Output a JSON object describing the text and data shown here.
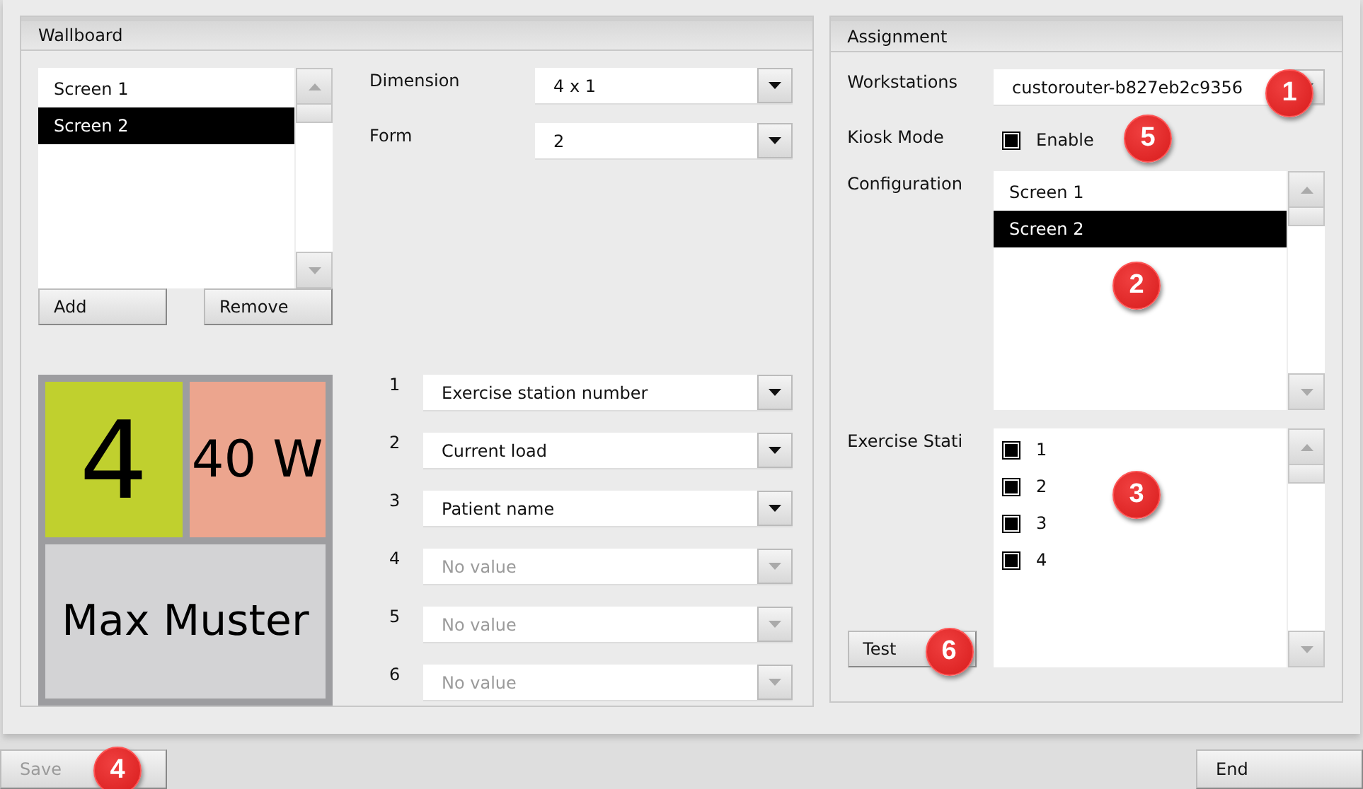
{
  "wallboard": {
    "title": "Wallboard",
    "screens": [
      {
        "label": "Screen 1",
        "selected": false
      },
      {
        "label": "Screen 2",
        "selected": true
      }
    ],
    "add_button": "Add",
    "remove_button": "Remove",
    "dimension": {
      "label": "Dimension",
      "value": "4 x 1"
    },
    "form": {
      "label": "Form",
      "value": "2"
    },
    "tiles": [
      {
        "kind": "number",
        "text": "4",
        "color": "#c0d02e"
      },
      {
        "kind": "load",
        "text": "40 W",
        "color": "#eca58e"
      },
      {
        "kind": "name",
        "text": "Max Muster",
        "color": "#d3d3d5"
      }
    ],
    "slots": [
      {
        "number": "1",
        "value": "Exercise station number",
        "disabled": false
      },
      {
        "number": "2",
        "value": "Current load",
        "disabled": false
      },
      {
        "number": "3",
        "value": "Patient name",
        "disabled": false
      },
      {
        "number": "4",
        "value": "No value",
        "disabled": true
      },
      {
        "number": "5",
        "value": "No value",
        "disabled": true
      },
      {
        "number": "6",
        "value": "No value",
        "disabled": true
      }
    ]
  },
  "assignment": {
    "title": "Assignment",
    "workstations": {
      "label": "Workstations",
      "value": "custorouter-b827eb2c9356",
      "callout": "1"
    },
    "kiosk_mode": {
      "label": "Kiosk Mode",
      "option": "Enable",
      "checked": true,
      "callout": "5"
    },
    "configuration": {
      "label": "Configuration",
      "callout": "2",
      "items": [
        {
          "label": "Screen 1",
          "selected": false
        },
        {
          "label": "Screen 2",
          "selected": true
        }
      ]
    },
    "exercise_stations": {
      "label": "Exercise Stati",
      "callout": "3",
      "items": [
        {
          "label": "1",
          "checked": true
        },
        {
          "label": "2",
          "checked": true
        },
        {
          "label": "3",
          "checked": true
        },
        {
          "label": "4",
          "checked": true
        }
      ]
    },
    "test_button": {
      "label": "Test",
      "callout": "6"
    }
  },
  "footer": {
    "save_button": {
      "label": "Save",
      "disabled": true,
      "callout": "4"
    },
    "end_button": {
      "label": "End"
    }
  }
}
